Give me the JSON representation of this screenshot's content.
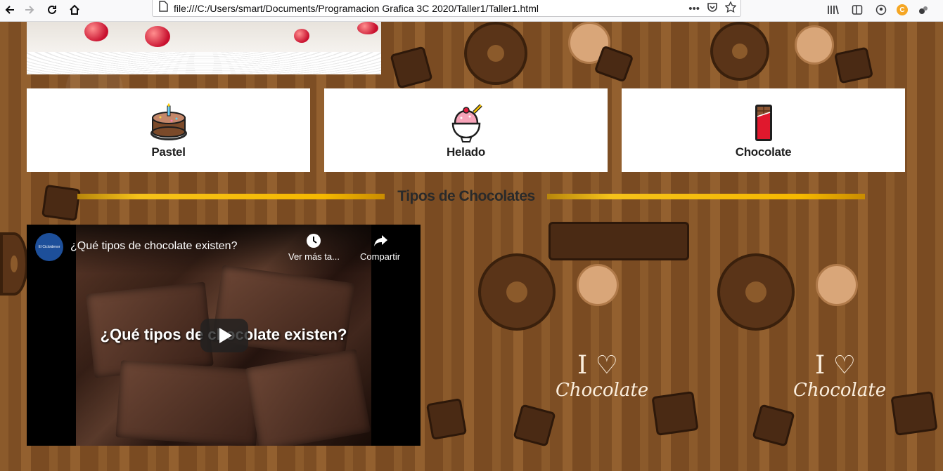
{
  "browser": {
    "url": "file:///C:/Users/smart/Documents/Programacion Grafica 3C 2020/Taller1/Taller1.html",
    "icons": [
      "back-icon",
      "forward-icon",
      "reload-icon",
      "home-icon",
      "file-icon",
      "more-icon",
      "pocket-icon",
      "bookmark-star-icon",
      "library-icon",
      "sidebar-icon",
      "account-icon",
      "extension-c-icon",
      "extension-icon"
    ],
    "more_glyph": "•••",
    "extension_c_label": "C"
  },
  "categories": [
    {
      "label": "Pastel",
      "icon": "cake-icon"
    },
    {
      "label": "Helado",
      "icon": "ice-cream-icon"
    },
    {
      "label": "Chocolate",
      "icon": "chocolate-bar-icon"
    }
  ],
  "section": {
    "title": "Tipos de Chocolates",
    "accent": "#f5b800"
  },
  "video": {
    "title": "¿Qué tipos de chocolate existen?",
    "overlay_title": "¿Qué tipos de chocolate existen?",
    "channel_label": "El Cicloidenor",
    "actions": [
      {
        "label": "Ver más ta...",
        "icon": "clock-icon"
      },
      {
        "label": "Compartir",
        "icon": "share-icon"
      }
    ]
  },
  "background": {
    "tile_text_big": "I ♡",
    "tile_text_small": "Chocolate"
  }
}
